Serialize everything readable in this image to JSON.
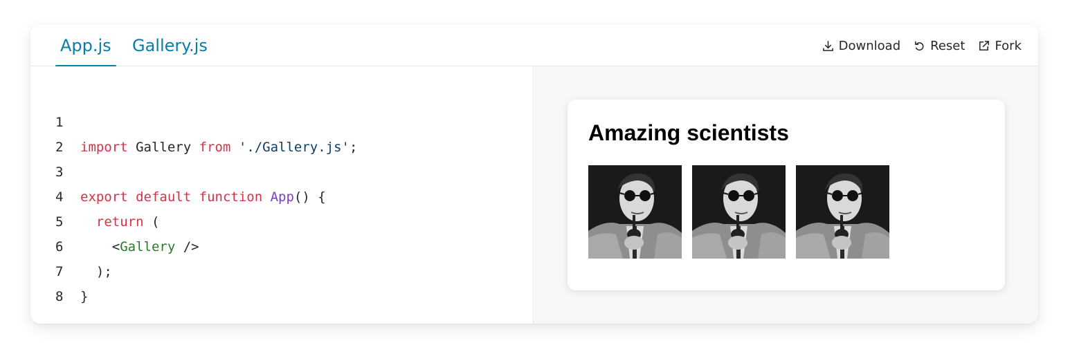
{
  "tabs": [
    {
      "label": "App.js",
      "active": true
    },
    {
      "label": "Gallery.js",
      "active": false
    }
  ],
  "actions": {
    "download": "Download",
    "reset": "Reset",
    "fork": "Fork"
  },
  "editor": {
    "line_numbers": [
      "1",
      "2",
      "3",
      "4",
      "5",
      "6",
      "7",
      "8"
    ],
    "lines": {
      "l1": {
        "kw1": "import",
        "t1": " Gallery ",
        "kw2": "from",
        "t2": " ",
        "str": "'./Gallery.js'",
        "t3": ";"
      },
      "l3": {
        "kw1": "export",
        "t1": " ",
        "kw2": "default",
        "t2": " ",
        "kw3": "function",
        "t3": " ",
        "fn": "App",
        "t4": "() {"
      },
      "l4": {
        "indent": "  ",
        "kw": "return",
        "t": " ("
      },
      "l5": {
        "indent": "    ",
        "lt": "<",
        "tag": "Gallery",
        "t": " />"
      },
      "l6": {
        "t": "  );"
      },
      "l7": {
        "t": "}"
      }
    }
  },
  "preview": {
    "heading": "Amazing scientists",
    "images": [
      {
        "alt": "scientist-photo"
      },
      {
        "alt": "scientist-photo"
      },
      {
        "alt": "scientist-photo"
      }
    ]
  },
  "colors": {
    "accent": "#087ea4",
    "keyword": "#d5324a",
    "string": "#0d3e66",
    "function": "#7a3fc8",
    "tag": "#2b7a2b"
  }
}
